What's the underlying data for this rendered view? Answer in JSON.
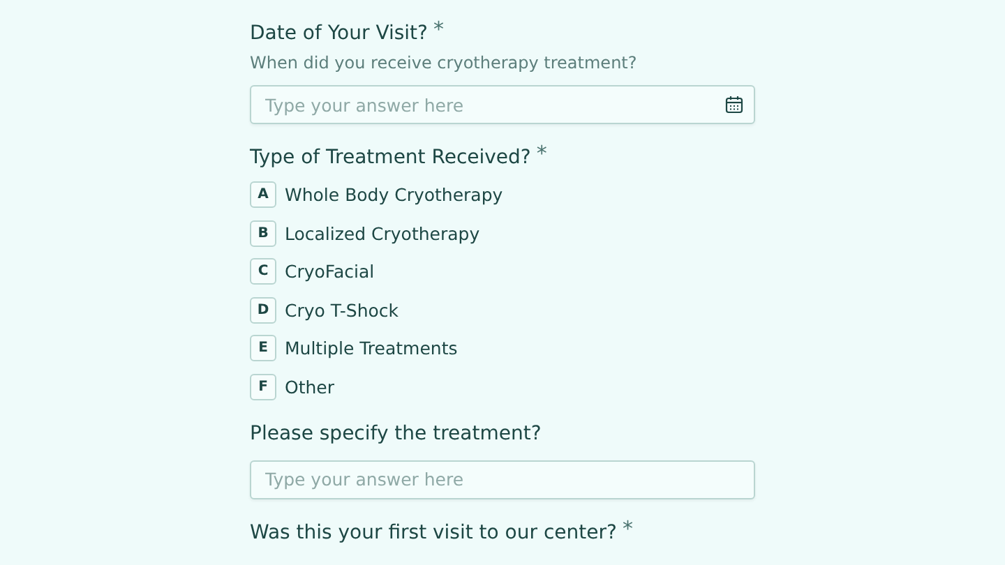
{
  "questions": [
    {
      "kind": "date",
      "title": "Date of Your Visit?",
      "asterisk": "*",
      "description": "When did you receive cryotherapy treatment?",
      "placeholder": "Type your answer here"
    },
    {
      "kind": "choice",
      "title": "Type of Treatment Received?",
      "asterisk": "*",
      "options": [
        {
          "key": "A",
          "label": "Whole Body Cryotherapy",
          "selected": false
        },
        {
          "key": "B",
          "label": "Localized Cryotherapy",
          "selected": false
        },
        {
          "key": "C",
          "label": "CryoFacial",
          "selected": false
        },
        {
          "key": "D",
          "label": "Cryo T-Shock",
          "selected": false
        },
        {
          "key": "E",
          "label": "Multiple Treatments",
          "selected": false
        },
        {
          "key": "F",
          "label": "Other",
          "selected": false
        }
      ]
    },
    {
      "kind": "text",
      "title": "Please specify the treatment?",
      "placeholder": "Type your answer here"
    },
    {
      "kind": "heading",
      "title": "Was this your first visit to our center?",
      "asterisk": "*"
    }
  ]
}
